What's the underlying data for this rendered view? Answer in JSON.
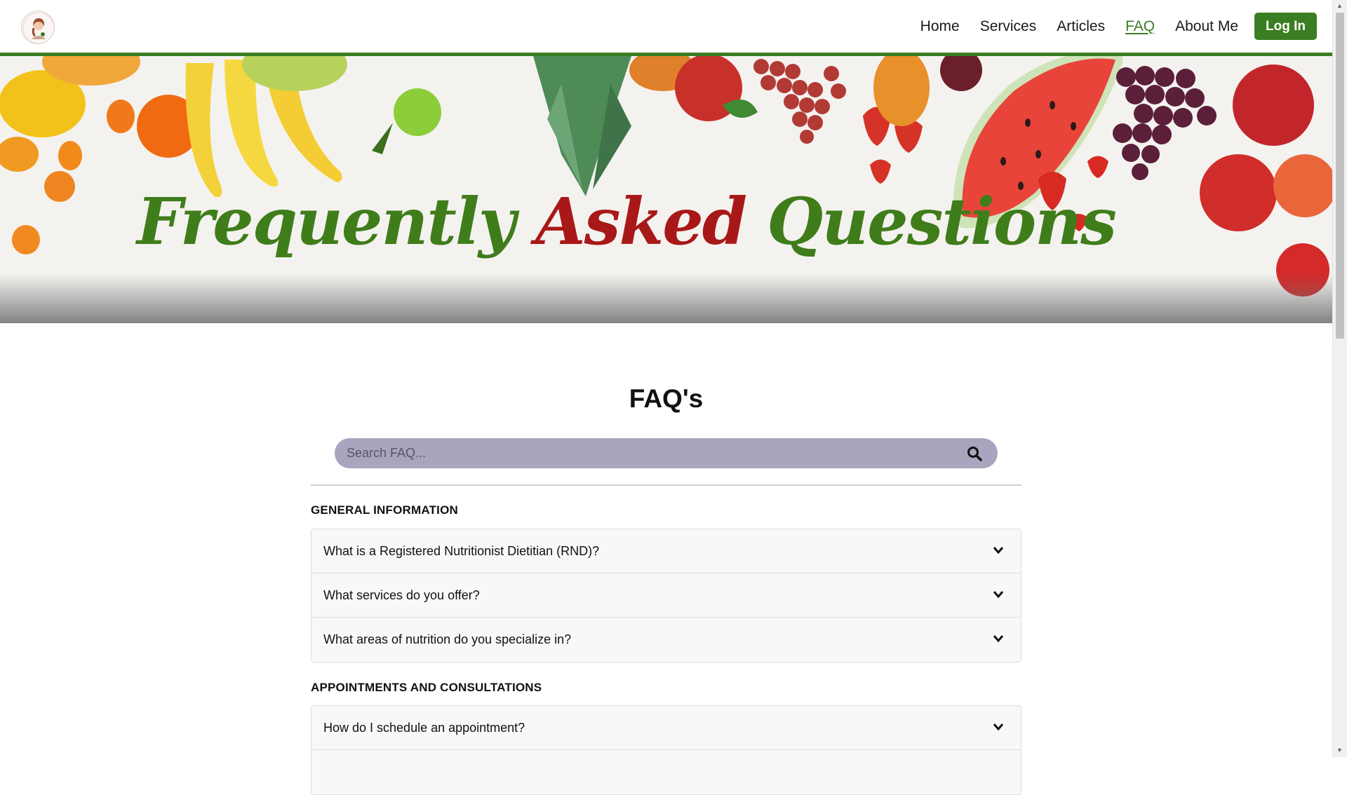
{
  "header": {
    "logo_icon": "nutritionist-avatar-logo",
    "nav": [
      {
        "label": "Home",
        "active": false
      },
      {
        "label": "Services",
        "active": false
      },
      {
        "label": "Articles",
        "active": false
      },
      {
        "label": "FAQ",
        "active": true
      },
      {
        "label": "About Me",
        "active": false
      }
    ],
    "login_label": "Log In"
  },
  "hero": {
    "title_words": [
      "Frequently",
      "Asked",
      "Questions"
    ],
    "colors": {
      "green": "#3f7d1b",
      "red": "#a81818"
    }
  },
  "main": {
    "heading": "FAQ's",
    "search": {
      "placeholder": "Search FAQ...",
      "value": "",
      "icon": "search-icon"
    },
    "sections": [
      {
        "title": "GENERAL INFORMATION",
        "questions": [
          "What is a Registered Nutritionist Dietitian (RND)?",
          "What services do you offer?",
          "What areas of nutrition do you specialize in?"
        ]
      },
      {
        "title": "APPOINTMENTS AND CONSULTATIONS",
        "questions": [
          "How do I schedule an appointment?",
          ""
        ]
      }
    ]
  },
  "theme": {
    "brand_green": "#3b7d23",
    "search_bg": "#a8a5be"
  }
}
